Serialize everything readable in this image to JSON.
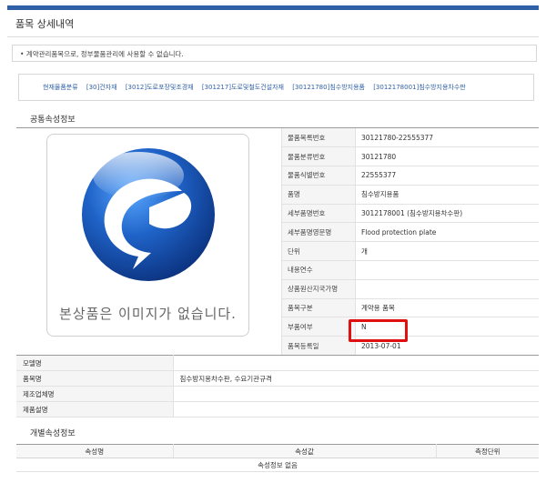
{
  "page_title": "품목 상세내역",
  "notice": "• 계약관리품목으로, 정부물품관리에 사용할 수 없습니다.",
  "categories": [
    "현재물품분류",
    "[30]건자재",
    "[3012]도로포장및조경재",
    "[301217]도로및철도건설자재",
    "[30121780]침수방지용품",
    "[3012178001]침수방지용차수판"
  ],
  "sections": {
    "common": "공통속성정보",
    "individual": "개별속성정보"
  },
  "product_image": {
    "alt_text": "본상품은 이미지가 없습니다.",
    "logo_color": "#1f63c8"
  },
  "specs": [
    {
      "label": "물품목록번호",
      "value": "30121780-22555377"
    },
    {
      "label": "물품분류번호",
      "value": "30121780"
    },
    {
      "label": "물품식별번호",
      "value": "22555377"
    },
    {
      "label": "품명",
      "value": "침수방지용품"
    },
    {
      "label": "세부품명번호",
      "value": "3012178001 (침수방지용차수판)"
    },
    {
      "label": "세부품명영문명",
      "value": "Flood protection plate"
    },
    {
      "label": "단위",
      "value": "개"
    },
    {
      "label": "내용연수",
      "value": ""
    },
    {
      "label": "상품원산지국가명",
      "value": ""
    },
    {
      "label": "품목구분",
      "value": "계약용 품목"
    },
    {
      "label": "부품여부",
      "value": "N"
    },
    {
      "label": "품목등록일",
      "value": "2013-07-01"
    }
  ],
  "extra": [
    {
      "label": "모델명",
      "value": ""
    },
    {
      "label": "품목명",
      "value": "침수방지용차수판, 수요기관규격"
    },
    {
      "label": "제조업체명",
      "value": ""
    },
    {
      "label": "제품설명",
      "value": ""
    }
  ],
  "attr_table": {
    "headers": [
      "속성명",
      "속성값",
      "측정단위"
    ],
    "empty_message": "속성정보 없음"
  },
  "colors": {
    "accent": "#2f5fa6",
    "highlight": "#e01010"
  }
}
